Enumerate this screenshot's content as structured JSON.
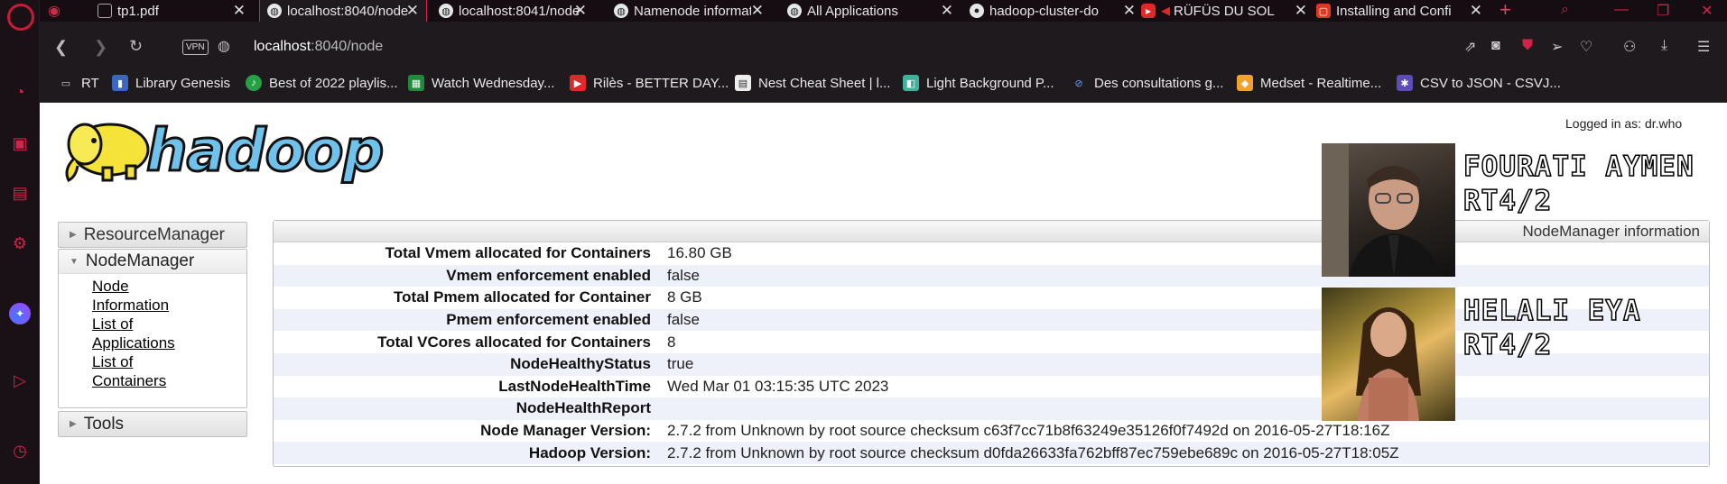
{
  "browser": {
    "tabs": [
      {
        "title": "",
        "icon": "gamepad-icon"
      },
      {
        "title": "tp1.pdf",
        "icon": "pdf-icon"
      },
      {
        "title": "localhost:8040/node",
        "icon": "globe-icon"
      },
      {
        "title": "localhost:8041/node",
        "icon": "globe-icon"
      },
      {
        "title": "Namenode information",
        "icon": "globe-icon"
      },
      {
        "title": "All Applications",
        "icon": "globe-icon"
      },
      {
        "title": "hadoop-cluster-do",
        "icon": "github-icon"
      },
      {
        "title": "RÜFÜS DU SOL",
        "icon": "youtube-icon"
      },
      {
        "title": "Installing and Confi",
        "icon": "office-icon"
      }
    ],
    "address": {
      "host": "localhost",
      "path": ":8040/node",
      "vpn_label": "VPN"
    },
    "bookmarks": [
      {
        "label": "RT",
        "icon": "folder-icon"
      },
      {
        "label": "Library Genesis",
        "icon": "book-icon"
      },
      {
        "label": "Best of 2022 playlis...",
        "icon": "music-icon"
      },
      {
        "label": "Watch Wednesday...",
        "icon": "grid-icon"
      },
      {
        "label": "Rilès - BETTER DAY...",
        "icon": "youtube-icon"
      },
      {
        "label": "Nest Cheat Sheet | l...",
        "icon": "doc-icon"
      },
      {
        "label": "Light Background P...",
        "icon": "palette-icon"
      },
      {
        "label": "Des consultations g...",
        "icon": "clip-icon"
      },
      {
        "label": "Medset - Realtime...",
        "icon": "fox-icon"
      },
      {
        "label": "CSV to JSON - CSVJ...",
        "icon": "json-icon"
      }
    ]
  },
  "page": {
    "logged_in": "Logged in as: dr.who",
    "logo_text": "hadoop",
    "nav": {
      "resource_manager": "ResourceManager",
      "node_manager": "NodeManager",
      "links": [
        "Node Information",
        "List of Applications",
        "List of Containers"
      ],
      "tools": "Tools"
    },
    "table": {
      "header": "NodeManager information",
      "rows": [
        {
          "key": "Total Vmem allocated for Containers",
          "value": "16.80 GB"
        },
        {
          "key": "Vmem enforcement enabled",
          "value": "false"
        },
        {
          "key": "Total Pmem allocated for Container",
          "value": "8 GB"
        },
        {
          "key": "Pmem enforcement enabled",
          "value": "false"
        },
        {
          "key": "Total VCores allocated for Containers",
          "value": "8"
        },
        {
          "key": "NodeHealthyStatus",
          "value": "true"
        },
        {
          "key": "LastNodeHealthTime",
          "value": "Wed Mar 01 03:15:35 UTC 2023"
        },
        {
          "key": "NodeHealthReport",
          "value": ""
        },
        {
          "key": "Node Manager Version:",
          "value": "2.7.2 from Unknown by root source checksum c63f7cc71b8f63249e35126f0f7492d on 2016-05-27T18:16Z"
        },
        {
          "key": "Hadoop Version:",
          "value": "2.7.2 from Unknown by root source checksum d0fda26633fa762bff87ec759ebe689c on 2016-05-27T18:05Z"
        }
      ]
    },
    "students": [
      {
        "name": "FOURATI AYMEN",
        "class": "RT4/2"
      },
      {
        "name": "HELALI EYA",
        "class": "RT4/2"
      }
    ]
  }
}
